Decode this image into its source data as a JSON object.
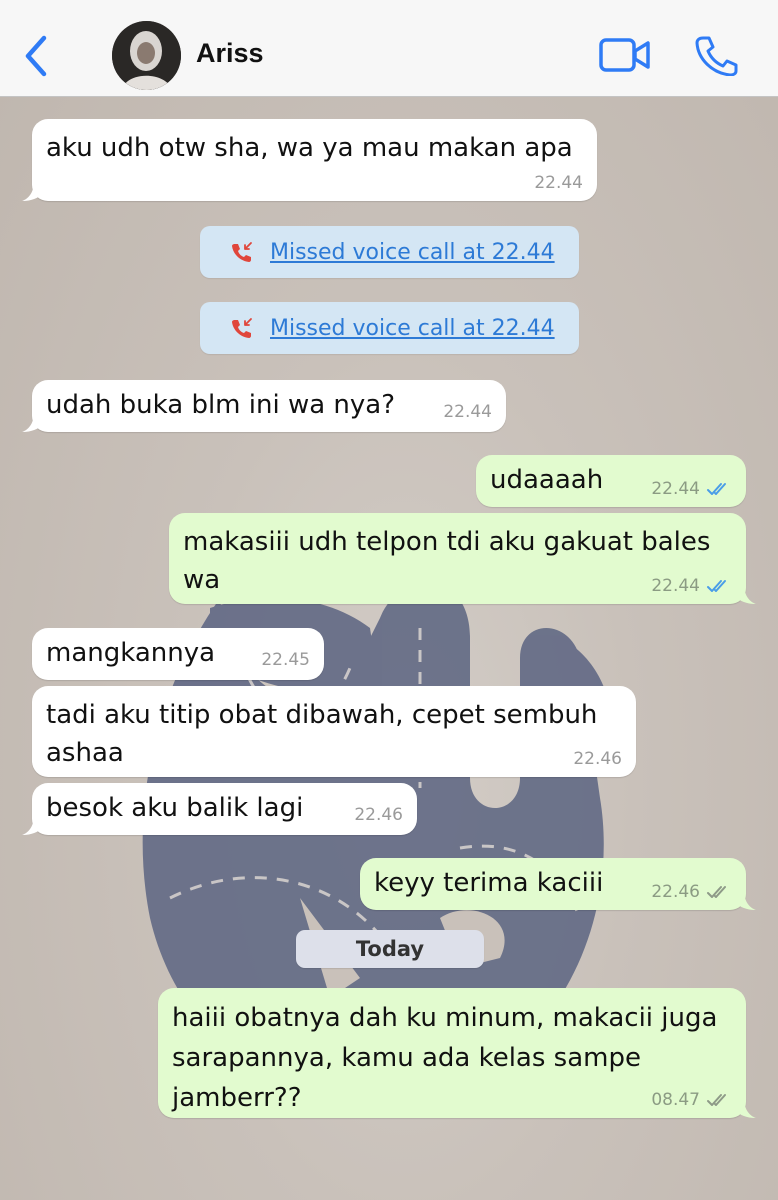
{
  "header": {
    "contact_name": "Ariss",
    "back_icon": "chevron-left-icon",
    "video_icon": "video-camera-icon",
    "phone_icon": "phone-icon",
    "accent_color": "#2f7bf5"
  },
  "messages": [
    {
      "direction": "in",
      "text": "aku udh otw sha, wa ya mau makan apa",
      "time": "22.44"
    },
    {
      "type": "system",
      "text": "Missed voice call at 22.44"
    },
    {
      "type": "system",
      "text": "Missed voice call at 22.44"
    },
    {
      "direction": "in",
      "text": "udah buka blm ini wa nya?",
      "time": "22.44"
    },
    {
      "direction": "out",
      "text": "udaaaah",
      "time": "22.44",
      "status": "read"
    },
    {
      "direction": "out",
      "text": "makasiii udh telpon tdi aku gakuat bales wa",
      "time": "22.44",
      "status": "read"
    },
    {
      "direction": "in",
      "text": "mangkannya",
      "time": "22.45"
    },
    {
      "direction": "in",
      "text": "tadi aku titip obat dibawah, cepet sembuh ashaa",
      "time": "22.46"
    },
    {
      "direction": "in",
      "text": "besok aku balik lagi",
      "time": "22.46"
    },
    {
      "direction": "out",
      "text": "keyy terima kaciii",
      "time": "22.46",
      "status": "delivered"
    },
    {
      "type": "date",
      "text": "Today"
    },
    {
      "direction": "out",
      "text": "haiii obatnya dah ku minum, makacii juga sarapannya, kamu ada kelas sampe jamberr??",
      "time": "08.47",
      "status": "delivered"
    }
  ],
  "colors": {
    "incoming_bubble": "#ffffff",
    "outgoing_bubble": "#e2fbcf",
    "read_tick": "#4a9de8",
    "delivered_tick": "#8e9a88",
    "missed_call_icon": "#e0463b",
    "missed_call_text": "#2d7ad6"
  }
}
